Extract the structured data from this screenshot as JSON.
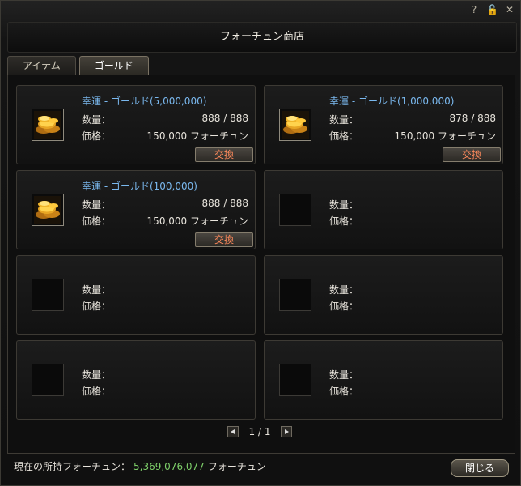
{
  "window": {
    "title": "フォーチュン商店"
  },
  "tabs": [
    {
      "label": "アイテム",
      "active": false
    },
    {
      "label": "ゴールド",
      "active": true
    }
  ],
  "labels": {
    "quantity": "数量：",
    "price": "価格：",
    "exchange": "交換"
  },
  "slots": [
    {
      "name": "幸運 - ゴールド(5,000,000)",
      "quantity": "888 / 888",
      "price": "150,000 フォーチュン",
      "icon": "gold-coins"
    },
    {
      "name": "幸運 - ゴールド(1,000,000)",
      "quantity": "878 / 888",
      "price": "150,000 フォーチュン",
      "icon": "gold-coins"
    },
    {
      "name": "幸運 - ゴールド(100,000)",
      "quantity": "888 / 888",
      "price": "150,000 フォーチュン",
      "icon": "gold-coins"
    },
    {
      "name": "",
      "quantity": "",
      "price": ""
    },
    {
      "name": "",
      "quantity": "",
      "price": ""
    },
    {
      "name": "",
      "quantity": "",
      "price": ""
    },
    {
      "name": "",
      "quantity": "",
      "price": ""
    },
    {
      "name": "",
      "quantity": "",
      "price": ""
    }
  ],
  "pager": {
    "text": "1 / 1"
  },
  "footer": {
    "label": "現在の所持フォーチュン：",
    "amount": "5,369,076,077",
    "unit": "フォーチュン",
    "close_label": "閉じる"
  },
  "icons": {
    "help": "help-icon",
    "lock": "lock-icon",
    "close": "close-icon"
  },
  "colors": {
    "item_name": "#7ab8ee",
    "amount": "#7ed06a",
    "exchange_text": "#ff8a5c"
  }
}
